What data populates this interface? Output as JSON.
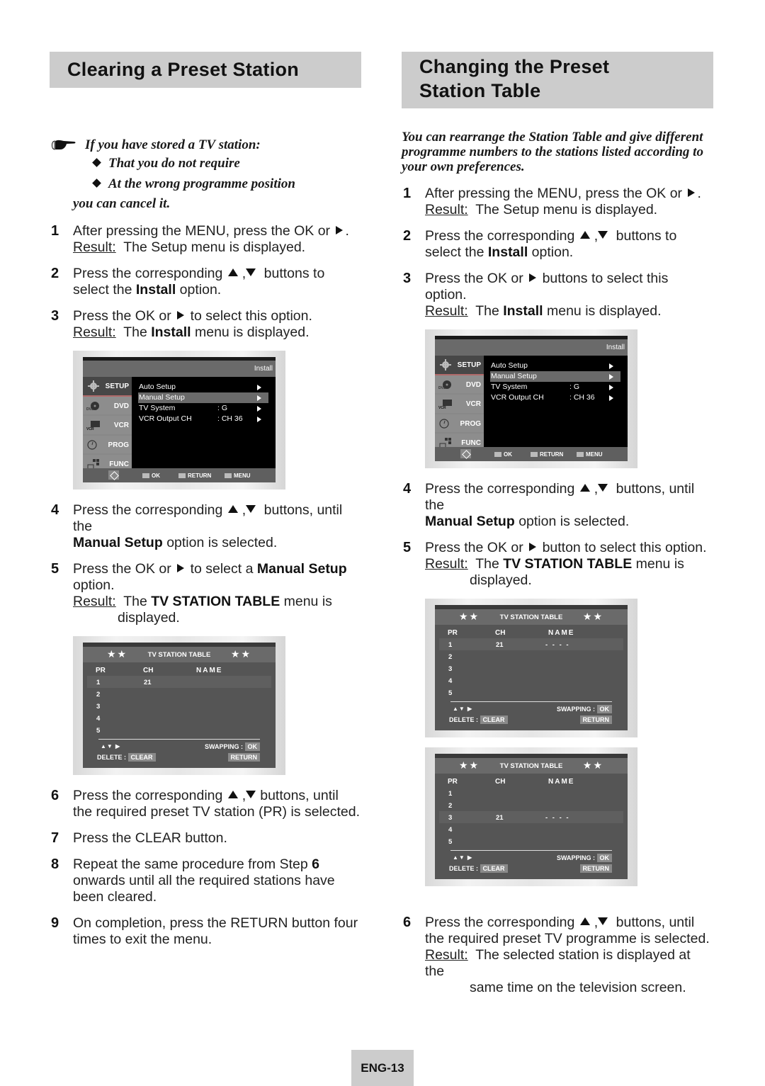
{
  "left": {
    "title": "Clearing a Preset Station",
    "note": {
      "icon": "pointing-hand-icon",
      "lead": "If you have stored a TV station:",
      "bullets": [
        "That you do not require",
        "At the wrong programme position"
      ],
      "tail": "you can cancel it."
    },
    "steps": [
      {
        "num": "1",
        "text": "After pressing the MENU, press the OK or",
        "end": ".",
        "result_label": "Result:",
        "result": "The Setup menu is displayed."
      },
      {
        "num": "2",
        "pre": "Press the corresponding",
        "post": "buttons to select the",
        "bold": "Install",
        "tail": "option."
      },
      {
        "num": "3",
        "pre": "Press the OK or",
        "post": "to select this option.",
        "result_label": "Result:",
        "result_pre": "The",
        "result_bold": "Install",
        "result_post": "menu is displayed."
      },
      {
        "num": "4",
        "pre": "Press the corresponding",
        "post": "buttons, until the",
        "bold": "Manual Setup",
        "tail": "option is selected."
      },
      {
        "num": "5",
        "pre": "Press the OK or",
        "post": "to select a",
        "bold": "Manual Setup",
        "tail": "option.",
        "result_label": "Result:",
        "result_pre": "The",
        "result_bold": "TV STATION TABLE",
        "result_post": "menu is",
        "result_line2": "displayed."
      },
      {
        "num": "6",
        "pre": "Press the corresponding",
        "post": "buttons, until the required preset TV station (PR) is selected."
      },
      {
        "num": "7",
        "text": "Press the CLEAR button."
      },
      {
        "num": "8",
        "pre": "Repeat the same procedure from Step",
        "bold": "6",
        "post": "onwards until all the required stations have been cleared."
      },
      {
        "num": "9",
        "text": "On completion, press the RETURN button four times to exit the menu."
      }
    ]
  },
  "right": {
    "title_line1": "Changing the Preset",
    "title_line2": "Station Table",
    "intro": "You can rearrange the Station Table and give different programme numbers to the stations listed according to your own preferences.",
    "steps": [
      {
        "num": "1",
        "text": "After pressing the MENU, press the OK or",
        "end": ".",
        "result_label": "Result:",
        "result": "The Setup menu is displayed."
      },
      {
        "num": "2",
        "pre": "Press the corresponding",
        "post": "buttons to select the",
        "bold": "Install",
        "tail": "option."
      },
      {
        "num": "3",
        "pre": "Press the OK or",
        "post": "buttons to select this option.",
        "result_label": "Result:",
        "result_pre": "The",
        "result_bold": "Install",
        "result_post": "menu is displayed."
      },
      {
        "num": "4",
        "pre": "Press the corresponding",
        "post": "buttons, until the",
        "bold": "Manual Setup",
        "tail": "option is selected."
      },
      {
        "num": "5",
        "pre": "Press the OK or",
        "post": "button to select this option.",
        "result_label": "Result:",
        "result_pre": "The",
        "result_bold": "TV STATION TABLE",
        "result_post": "menu is",
        "result_line2": "displayed."
      },
      {
        "num": "6",
        "pre": "Press the corresponding",
        "post": "buttons, until the required preset TV programme is selected.",
        "result_label": "Result:",
        "result": "The selected station is displayed at the",
        "result_line2": "same time on the television screen."
      }
    ]
  },
  "install_menu": {
    "header": "Install",
    "sidebar": [
      {
        "label": "SETUP",
        "icon": "gear-icon",
        "active": true
      },
      {
        "label": "DVD",
        "icon": "dvd-disc-icon"
      },
      {
        "label": "VCR",
        "icon": "vcr-tape-icon"
      },
      {
        "label": "PROG",
        "icon": "clock-icon"
      },
      {
        "label": "FUNC",
        "icon": "hand-grid-icon"
      }
    ],
    "items": [
      {
        "label": "Auto Setup",
        "value": ""
      },
      {
        "label": "Manual Setup",
        "value": "",
        "selected": true
      },
      {
        "label": "TV System",
        "value": ": G"
      },
      {
        "label": "VCR Output CH",
        "value": ": CH 36"
      }
    ],
    "footer": {
      "ok": "OK",
      "return": "RETURN",
      "menu": "MENU"
    }
  },
  "station_table": {
    "title": "TV STATION TABLE",
    "stars": "★★",
    "columns": [
      "PR",
      "CH",
      "NAME"
    ],
    "nav_hint": "▲▼ ▶",
    "delete_label": "DELETE :",
    "clear_key": "CLEAR",
    "swap_label": "SWAPPING :",
    "ok_key": "OK",
    "return_key": "RETURN",
    "variants": {
      "left": [
        {
          "pr": "1",
          "ch": "21",
          "name": "",
          "sel": true
        },
        {
          "pr": "2",
          "ch": "",
          "name": ""
        },
        {
          "pr": "3",
          "ch": "",
          "name": ""
        },
        {
          "pr": "4",
          "ch": "",
          "name": ""
        },
        {
          "pr": "5",
          "ch": "",
          "name": ""
        }
      ],
      "right_a": [
        {
          "pr": "1",
          "ch": "21",
          "name": "- - - -",
          "sel": true
        },
        {
          "pr": "2",
          "ch": "",
          "name": ""
        },
        {
          "pr": "3",
          "ch": "",
          "name": ""
        },
        {
          "pr": "4",
          "ch": "",
          "name": ""
        },
        {
          "pr": "5",
          "ch": "",
          "name": ""
        }
      ],
      "right_b": [
        {
          "pr": "1",
          "ch": "",
          "name": ""
        },
        {
          "pr": "2",
          "ch": "",
          "name": ""
        },
        {
          "pr": "3",
          "ch": "21",
          "name": "- - - -",
          "sel": true
        },
        {
          "pr": "4",
          "ch": "",
          "name": ""
        },
        {
          "pr": "5",
          "ch": "",
          "name": ""
        }
      ]
    }
  },
  "page_number": "ENG-13"
}
